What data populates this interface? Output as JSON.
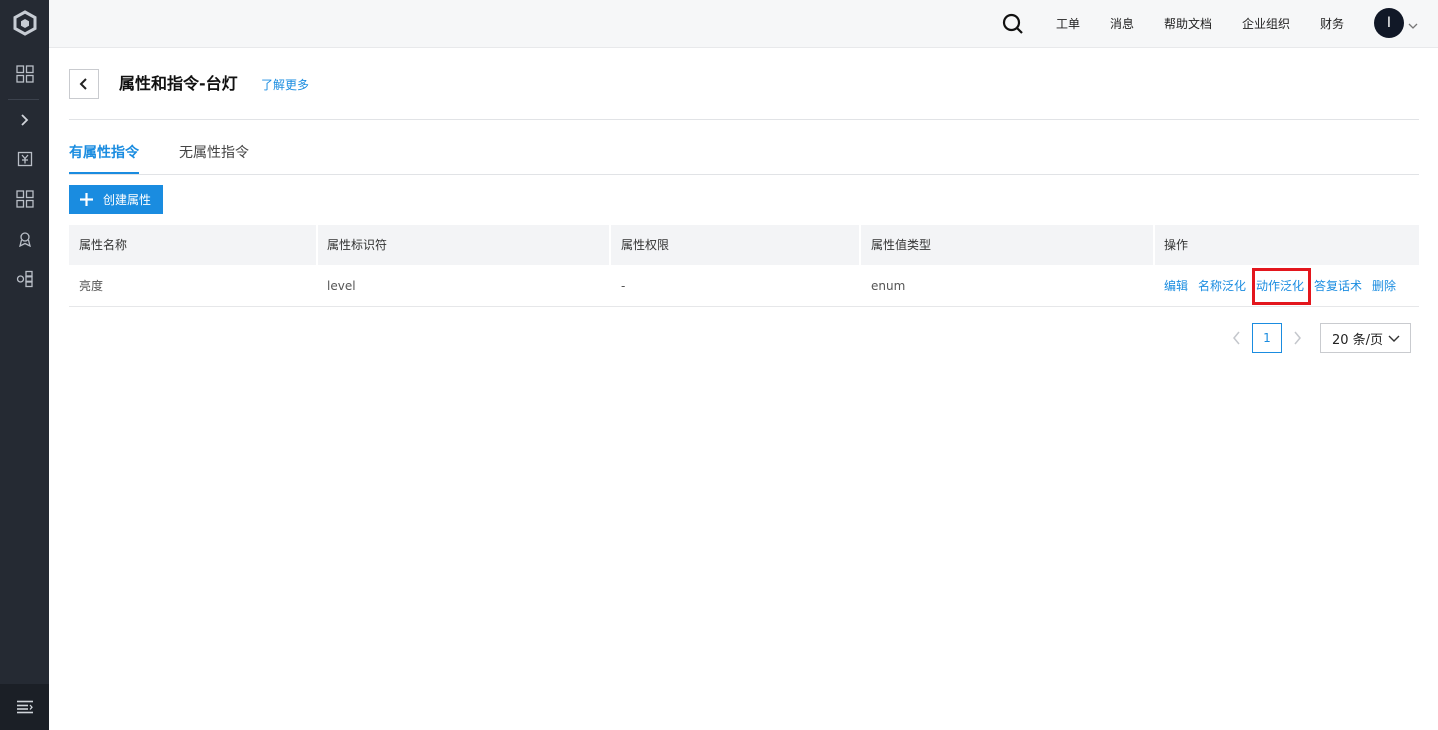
{
  "sidebar": {
    "icons": [
      "logo-icon",
      "dashboard-icon",
      "expand-icon",
      "document-icon",
      "apps-icon",
      "badge-icon",
      "cube-icon",
      "menu-icon"
    ]
  },
  "topbar": {
    "links": [
      "工单",
      "消息",
      "帮助文档",
      "企业组织",
      "财务"
    ],
    "avatar_letter": "I"
  },
  "header": {
    "title": "属性和指令-台灯",
    "learn_more": "了解更多"
  },
  "tabs": [
    {
      "label": "有属性指令",
      "active": true
    },
    {
      "label": "无属性指令",
      "active": false
    }
  ],
  "create_button": "创建属性",
  "table": {
    "columns": [
      "属性名称",
      "属性标识符",
      "属性权限",
      "属性值类型",
      "操作"
    ],
    "rows": [
      {
        "name": "亮度",
        "identifier": "level",
        "permission": "-",
        "value_type": "enum",
        "actions": [
          "编辑",
          "名称泛化",
          "动作泛化",
          "答复话术",
          "删除"
        ]
      }
    ]
  },
  "pagination": {
    "current_page": "1",
    "page_size": "20 条/页"
  },
  "colors": {
    "accent": "#1a8ce0",
    "sidebar_bg": "#252a33",
    "highlight": "#e3161d"
  }
}
